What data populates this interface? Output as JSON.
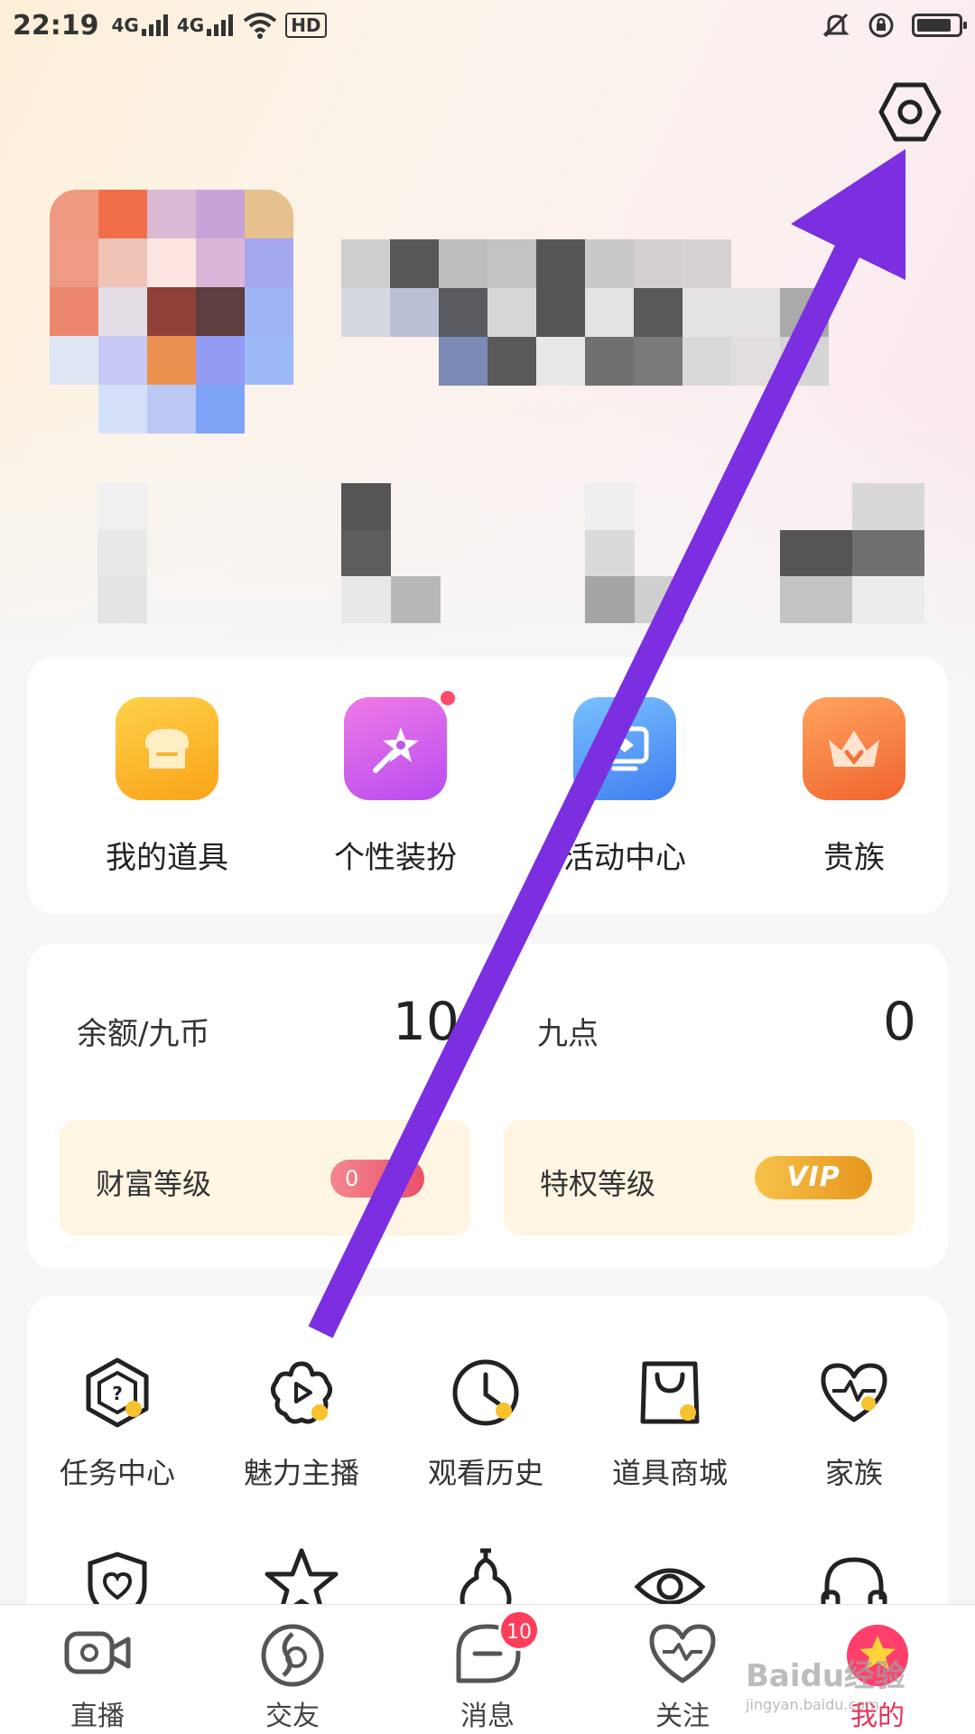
{
  "status_bar": {
    "time": "22:19",
    "network1": "4G",
    "network2": "4G",
    "hd": "HD"
  },
  "features": [
    {
      "label": "我的道具",
      "icon": "toast-icon"
    },
    {
      "label": "个性装扮",
      "icon": "magic-wand-icon"
    },
    {
      "label": "活动中心",
      "icon": "activity-icon"
    },
    {
      "label": "贵族",
      "icon": "crown-icon"
    }
  ],
  "balance": {
    "coin_label": "余额/九币",
    "coin_value": "10",
    "points_label": "九点",
    "points_value": "0",
    "wealth_label": "财富等级",
    "wealth_badge": "0",
    "privilege_label": "特权等级",
    "privilege_badge": "VIP"
  },
  "services": [
    {
      "label": "任务中心",
      "icon": "task-icon"
    },
    {
      "label": "魅力主播",
      "icon": "flower-play-icon"
    },
    {
      "label": "观看历史",
      "icon": "clock-icon"
    },
    {
      "label": "道具商城",
      "icon": "shopping-bag-icon"
    },
    {
      "label": "家族",
      "icon": "heart-pulse-icon"
    }
  ],
  "bottom_nav": [
    {
      "label": "直播",
      "icon": "camera-icon"
    },
    {
      "label": "交友",
      "icon": "friends-icon"
    },
    {
      "label": "消息",
      "icon": "message-icon"
    },
    {
      "label": "关注",
      "icon": "heart-icon"
    },
    {
      "label": "我的",
      "icon": "star-icon",
      "active": true
    }
  ],
  "message_badge": "10",
  "watermark": {
    "brand": "Baidu经验",
    "url": "jingyan.baidu.com"
  },
  "colors": {
    "accent": "#e8335a",
    "arrow": "#7b2fe0"
  }
}
